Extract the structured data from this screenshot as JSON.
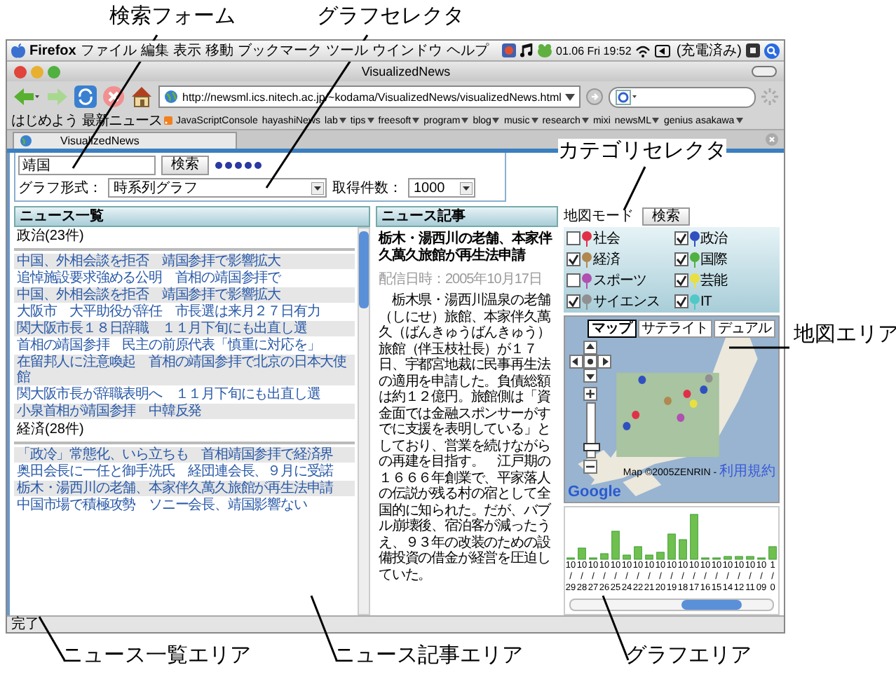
{
  "annotations": [
    {
      "label": "検索フォーム"
    },
    {
      "label": "グラフセレクタ"
    },
    {
      "label": "カテゴリセレクタ"
    },
    {
      "label": "地図エリア"
    },
    {
      "label": "ニュース一覧エリア"
    },
    {
      "label": "ニュース記事エリア"
    },
    {
      "label": "グラフエリア"
    }
  ],
  "menu_bar": {
    "app": "Firefox",
    "items": [
      "ファイル",
      "編集",
      "表示",
      "移動",
      "ブックマーク",
      "ツール",
      "ウインドウ",
      "ヘルプ"
    ],
    "clock": "01.06 Fri 19:52",
    "battery": "(充電済み)"
  },
  "window": {
    "title": "VisualizedNews"
  },
  "toolbar": {
    "url": "http://newsml.ics.nitech.ac.jp/~kodama/VisualizedNews/visualizedNews.html"
  },
  "bookmarks": [
    {
      "label": "はじめよう",
      "folder": false,
      "feed": false
    },
    {
      "label": "最新ニュース",
      "folder": false,
      "feed": true
    },
    {
      "label": "JavaScriptConsole",
      "folder": false,
      "feed": false
    },
    {
      "label": "hayashiNews",
      "folder": false,
      "feed": false
    },
    {
      "label": "lab",
      "folder": true,
      "feed": false
    },
    {
      "label": "tips",
      "folder": true,
      "feed": false
    },
    {
      "label": "freesoft",
      "folder": true,
      "feed": false
    },
    {
      "label": "program",
      "folder": true,
      "feed": false
    },
    {
      "label": "blog",
      "folder": true,
      "feed": false
    },
    {
      "label": "music",
      "folder": true,
      "feed": false
    },
    {
      "label": "research",
      "folder": true,
      "feed": false
    },
    {
      "label": "mixi",
      "folder": false,
      "feed": false
    },
    {
      "label": "newsML",
      "folder": true,
      "feed": false
    },
    {
      "label": "genius asakawa",
      "folder": true,
      "feed": false
    }
  ],
  "tab": {
    "title": "VisualizedNews"
  },
  "search_form": {
    "query": "靖国",
    "button": "検索",
    "graph_type_label": "グラフ形式：",
    "graph_type": "時系列グラフ",
    "count_label": "取得件数：",
    "count": "1000"
  },
  "news_list": {
    "title": "ニュース一覧",
    "groups": [
      {
        "name": "政治(23件)",
        "items": [
          "中国、外相会談を拒否　靖国参拝で影響拡大",
          "追悼施設要求強める公明　首相の靖国参拝で",
          "中国、外相会談を拒否　靖国参拝で影響拡大",
          "大阪市　大平助役が辞任　市長選は来月２７日有力",
          "関大阪市長１８日辞職　１１月下旬にも出直し選",
          "首相の靖国参拝　民主の前原代表「慎重に対応を」",
          "在留邦人に注意喚起　首相の靖国参拝で北京の日本大使館",
          "関大阪市長が辞職表明へ　１１月下旬にも出直し選",
          "小泉首相が靖国参拝　中韓反発"
        ]
      },
      {
        "name": "経済(28件)",
        "items": [
          "「政冷」常態化、いら立ちも　首相靖国参拝で経済界",
          "奥田会長に一任と御手洗氏　経団連会長、９月に受諾",
          "栃木・湯西川の老舗、本家伴久萬久旅館が再生法申請",
          "中国市場で積極攻勢　ソニー会長、靖国影響ない"
        ]
      }
    ]
  },
  "article": {
    "header": "ニュース記事",
    "title": "栃木・湯西川の老舗、本家伴久萬久旅館が再生法申請",
    "date": "配信日時：2005年10月17日",
    "body": "　栃木県・湯西川温泉の老舗（しにせ）旅館、本家伴久萬久（ばんきゅうばんきゅう）旅館（伴玉枝社長）が１７日、宇都宮地裁に民事再生法の適用を申請した。負債総額は約１２億円。旅館側は「資金面では金融スポンサーがすでに支援を表明している」としており、営業を続けながらの再建を目指す。　江戸期の１６６６年創業で、平家落人の伝説が残る村の宿として全国的に知られた。だが、バブル崩壊後、宿泊客が減ったうえ、９３年の改装のための設備投資の借金が経営を圧迫していた。"
  },
  "map": {
    "mode_label": "地図モード",
    "search_button": "検索",
    "categories": [
      {
        "label": "社会",
        "checked": false,
        "color": "#e03048"
      },
      {
        "label": "政治",
        "checked": true,
        "color": "#3050c0"
      },
      {
        "label": "経済",
        "checked": true,
        "color": "#b08850"
      },
      {
        "label": "国際",
        "checked": true,
        "color": "#50b040"
      },
      {
        "label": "スポーツ",
        "checked": false,
        "color": "#b050b0"
      },
      {
        "label": "芸能",
        "checked": true,
        "color": "#e8e040"
      },
      {
        "label": "サイエンス",
        "checked": true,
        "color": "#909090"
      },
      {
        "label": "IT",
        "checked": true,
        "color": "#50c8c8"
      }
    ],
    "map_types": [
      {
        "label": "マップ",
        "selected": true
      },
      {
        "label": "サテライト",
        "selected": false
      },
      {
        "label": "デュアル",
        "selected": false
      }
    ],
    "zoom": {
      "level": 0.2
    },
    "logo": "Google",
    "attribution": "Map ©2005ZENRIN - ",
    "terms_link": "利用規約"
  },
  "graph": {
    "dates": [
      {
        "month": "10",
        "sep": "/",
        "day": "29"
      },
      {
        "month": "10",
        "sep": "/",
        "day": "28"
      },
      {
        "month": "10",
        "sep": "/",
        "day": "27"
      },
      {
        "month": "10",
        "sep": "/",
        "day": "26"
      },
      {
        "month": "10",
        "sep": "/",
        "day": "25"
      },
      {
        "month": "10",
        "sep": "/",
        "day": "24"
      },
      {
        "month": "10",
        "sep": "/",
        "day": "22"
      },
      {
        "month": "10",
        "sep": "/",
        "day": "21"
      },
      {
        "month": "10",
        "sep": "/",
        "day": "20"
      },
      {
        "month": "10",
        "sep": "/",
        "day": "19"
      },
      {
        "month": "10",
        "sep": "/",
        "day": "18"
      },
      {
        "month": "10",
        "sep": "/",
        "day": "17"
      },
      {
        "month": "10",
        "sep": "/",
        "day": "16"
      },
      {
        "month": "10",
        "sep": "/",
        "day": "15"
      },
      {
        "month": "10",
        "sep": "/",
        "day": "14"
      },
      {
        "month": "10",
        "sep": "/",
        "day": "12"
      },
      {
        "month": "10",
        "sep": "/",
        "day": "11"
      },
      {
        "month": "10",
        "sep": "/",
        "day": "09"
      },
      {
        "month": "1",
        "sep": "/",
        "day": "0"
      }
    ]
  },
  "status_bar": "完了"
}
